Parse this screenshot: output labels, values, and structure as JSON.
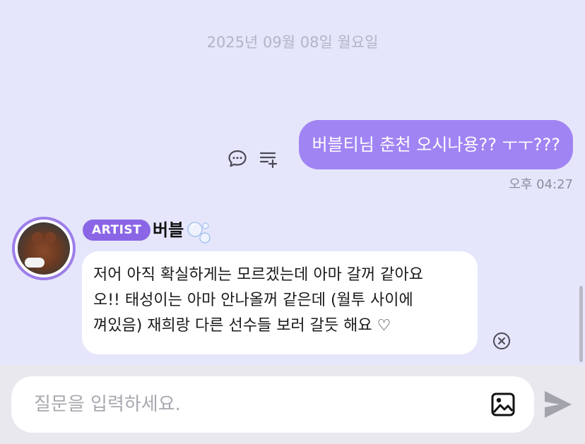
{
  "chat": {
    "date_divider": "2025년 09월 08일 월요일",
    "sent_message": {
      "text": "버블티님 춘천 오시나용?? ㅜㅜ???",
      "time": "오후 04:27"
    },
    "received_message": {
      "badge": "ARTIST",
      "sender": "버블",
      "lines": [
        "저어 아직 확실하게는 모르겠는데 아마 갈꺼 같아요",
        "오!! 태성이는 아마 안나올꺼 같은데 (월투 사이에",
        "껴있음) 재희랑 다른 선수들 보러 갈듯 해요 ♡"
      ]
    },
    "icons": {
      "chat": "chat-bubble-icon",
      "list": "playlist-add-icon",
      "bubbles": "soap-bubbles-icon",
      "close": "close-circle-icon"
    }
  },
  "input": {
    "placeholder": "질문을 입력하세요.",
    "image_icon": "image-icon",
    "send_icon": "send-icon"
  },
  "colors": {
    "background": "#e5e6fb",
    "sent_bubble": "#a184f3",
    "artist_badge": "#8a66e6",
    "avatar_ring": "#9d7ee9"
  }
}
